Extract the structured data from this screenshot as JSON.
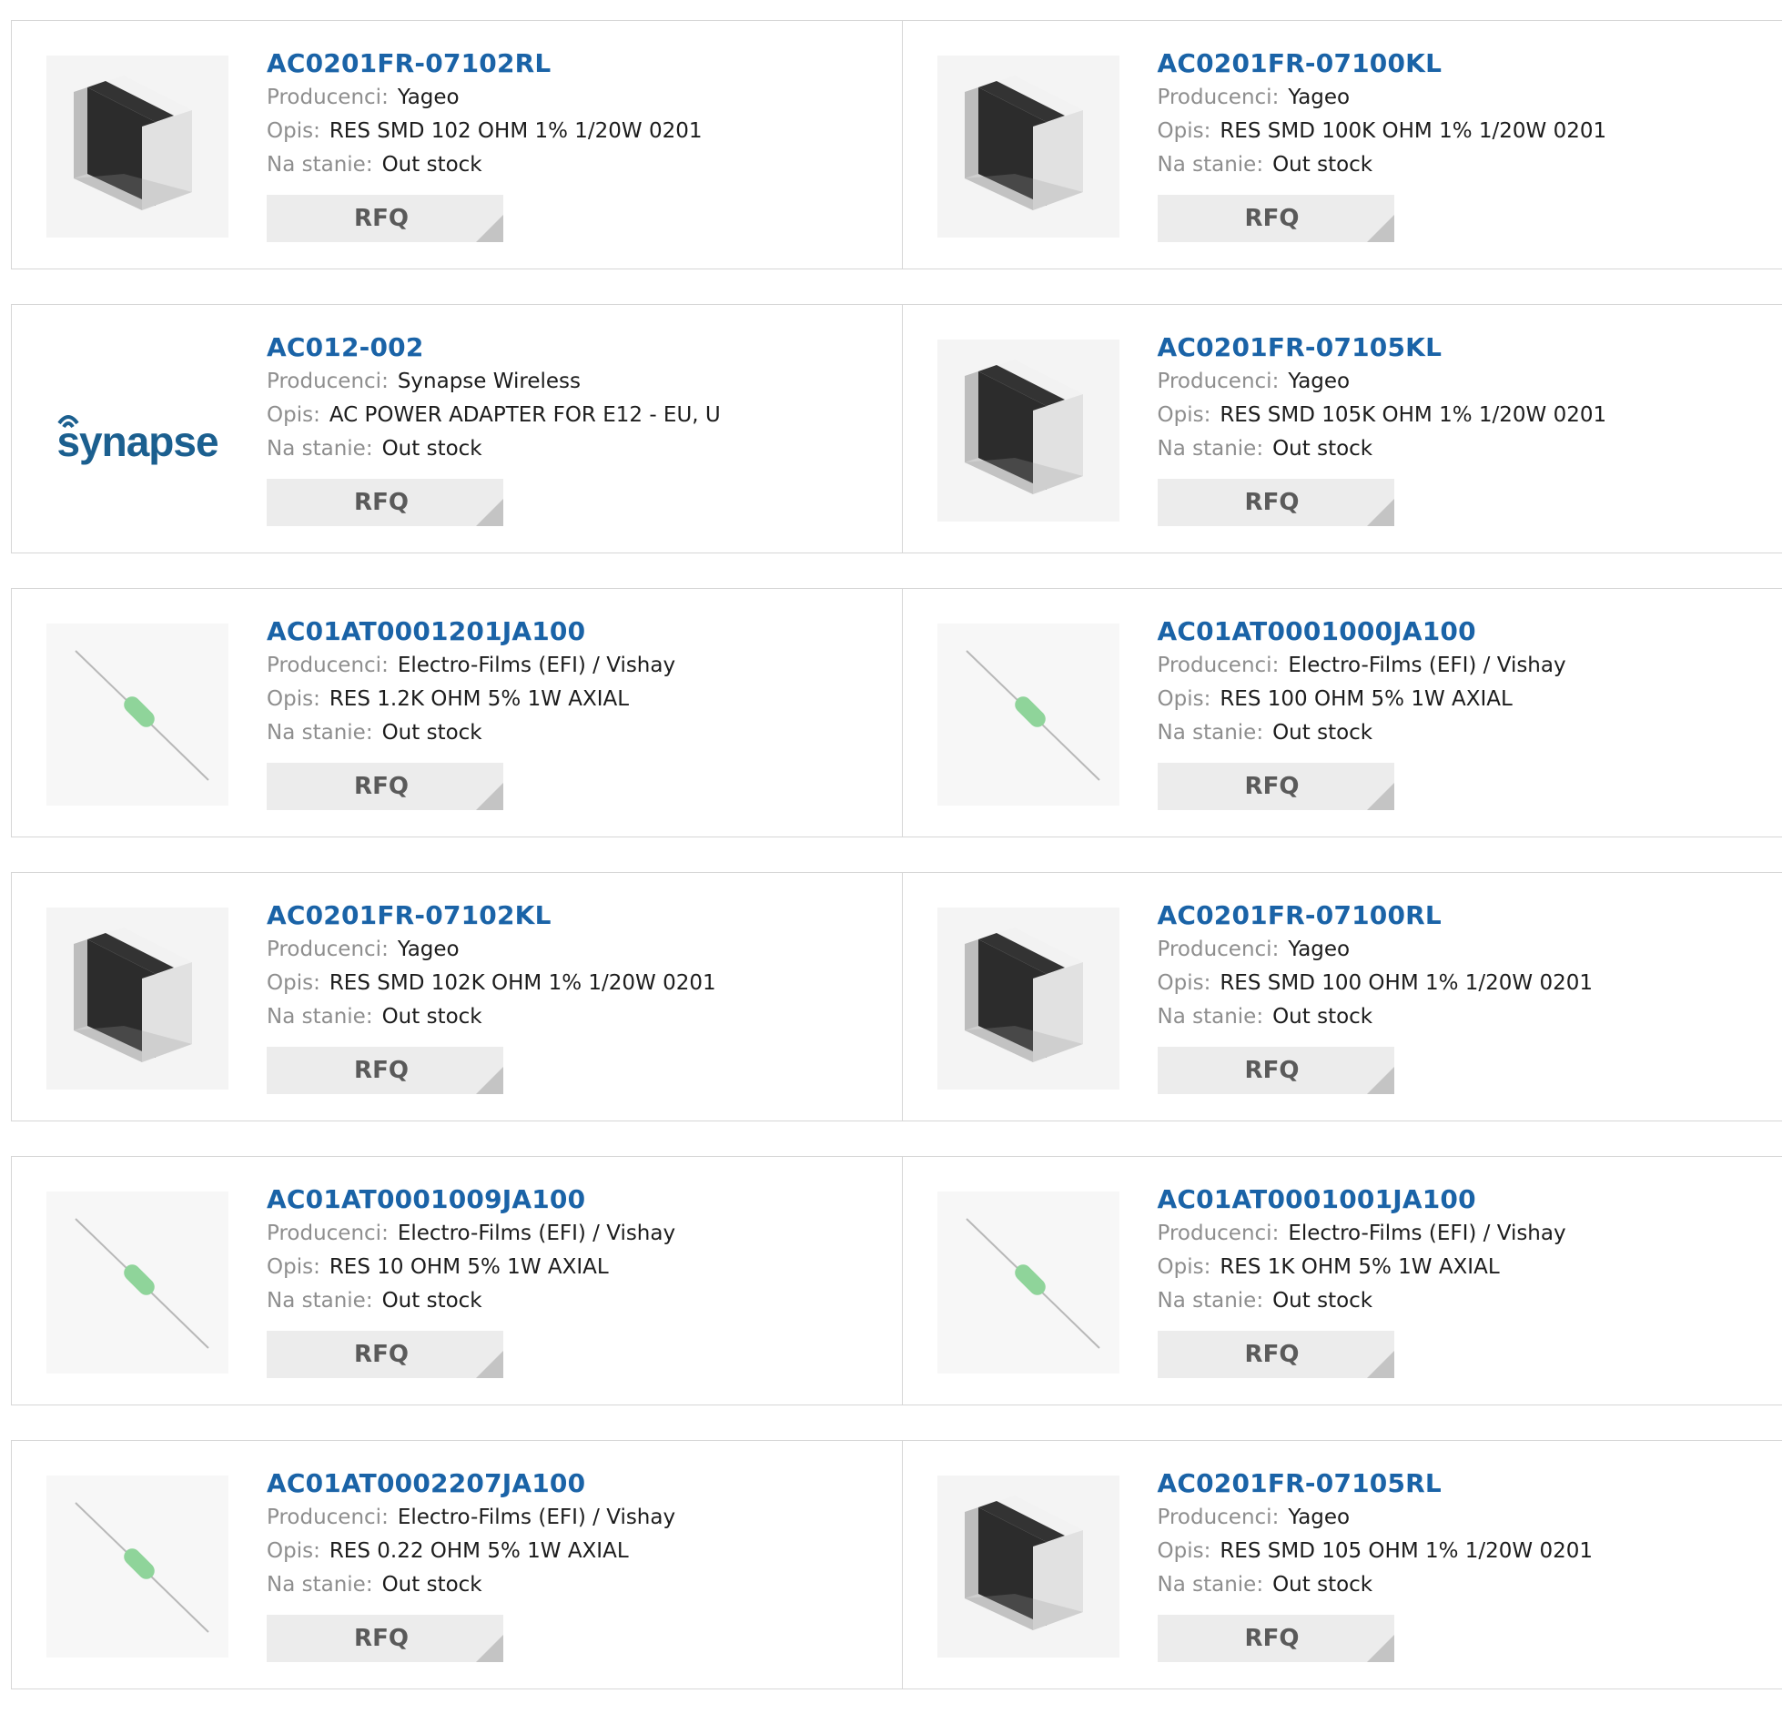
{
  "labels": {
    "manufacturer": "Producenci:",
    "description": "Opis:",
    "stock": "Na stanie:",
    "rfq": "RFQ"
  },
  "rows": [
    [
      {
        "part": "AC0201FR-07102RL",
        "manufacturer": "Yageo",
        "description": "RES SMD 102 OHM 1% 1/20W 0201",
        "stock": "Out stock",
        "image": "chip-resistor-image"
      },
      {
        "part": "AC0201FR-07100KL",
        "manufacturer": "Yageo",
        "description": "RES SMD 100K OHM 1% 1/20W 0201",
        "stock": "Out stock",
        "image": "chip-resistor-image"
      }
    ],
    [
      {
        "part": "AC012-002",
        "manufacturer": "Synapse Wireless",
        "description": "AC POWER ADAPTER FOR E12 - EU, U",
        "stock": "Out stock",
        "image": "synapse-logo",
        "logo_text": "synapse"
      },
      {
        "part": "AC0201FR-07105KL",
        "manufacturer": "Yageo",
        "description": "RES SMD 105K OHM 1% 1/20W 0201",
        "stock": "Out stock",
        "image": "chip-resistor-image"
      }
    ],
    [
      {
        "part": "AC01AT0001201JA100",
        "manufacturer": "Electro-Films (EFI) / Vishay",
        "description": "RES 1.2K OHM 5% 1W AXIAL",
        "stock": "Out stock",
        "image": "axial-resistor-image"
      },
      {
        "part": "AC01AT0001000JA100",
        "manufacturer": "Electro-Films (EFI) / Vishay",
        "description": "RES 100 OHM 5% 1W AXIAL",
        "stock": "Out stock",
        "image": "axial-resistor-image"
      }
    ],
    [
      {
        "part": "AC0201FR-07102KL",
        "manufacturer": "Yageo",
        "description": "RES SMD 102K OHM 1% 1/20W 0201",
        "stock": "Out stock",
        "image": "chip-resistor-image"
      },
      {
        "part": "AC0201FR-07100RL",
        "manufacturer": "Yageo",
        "description": "RES SMD 100 OHM 1% 1/20W 0201",
        "stock": "Out stock",
        "image": "chip-resistor-image"
      }
    ],
    [
      {
        "part": "AC01AT0001009JA100",
        "manufacturer": "Electro-Films (EFI) / Vishay",
        "description": "RES 10 OHM 5% 1W AXIAL",
        "stock": "Out stock",
        "image": "axial-resistor-image"
      },
      {
        "part": "AC01AT0001001JA100",
        "manufacturer": "Electro-Films (EFI) / Vishay",
        "description": "RES 1K OHM 5% 1W AXIAL",
        "stock": "Out stock",
        "image": "axial-resistor-image"
      }
    ],
    [
      {
        "part": "AC01AT0002207JA100",
        "manufacturer": "Electro-Films (EFI) / Vishay",
        "description": "RES 0.22 OHM 5% 1W AXIAL",
        "stock": "Out stock",
        "image": "axial-resistor-image"
      },
      {
        "part": "AC0201FR-07105RL",
        "manufacturer": "Yageo",
        "description": "RES SMD 105 OHM 1% 1/20W 0201",
        "stock": "Out stock",
        "image": "chip-resistor-image"
      }
    ]
  ],
  "colors": {
    "link": "#1a63a7",
    "label": "#8e8e8e",
    "value": "#1c1c1c",
    "border": "#d6d6d6",
    "button_bg": "#ececec",
    "button_text": "#5a5a5a",
    "axial_body": "#8fd49a",
    "logo": "#1b5f8f"
  }
}
